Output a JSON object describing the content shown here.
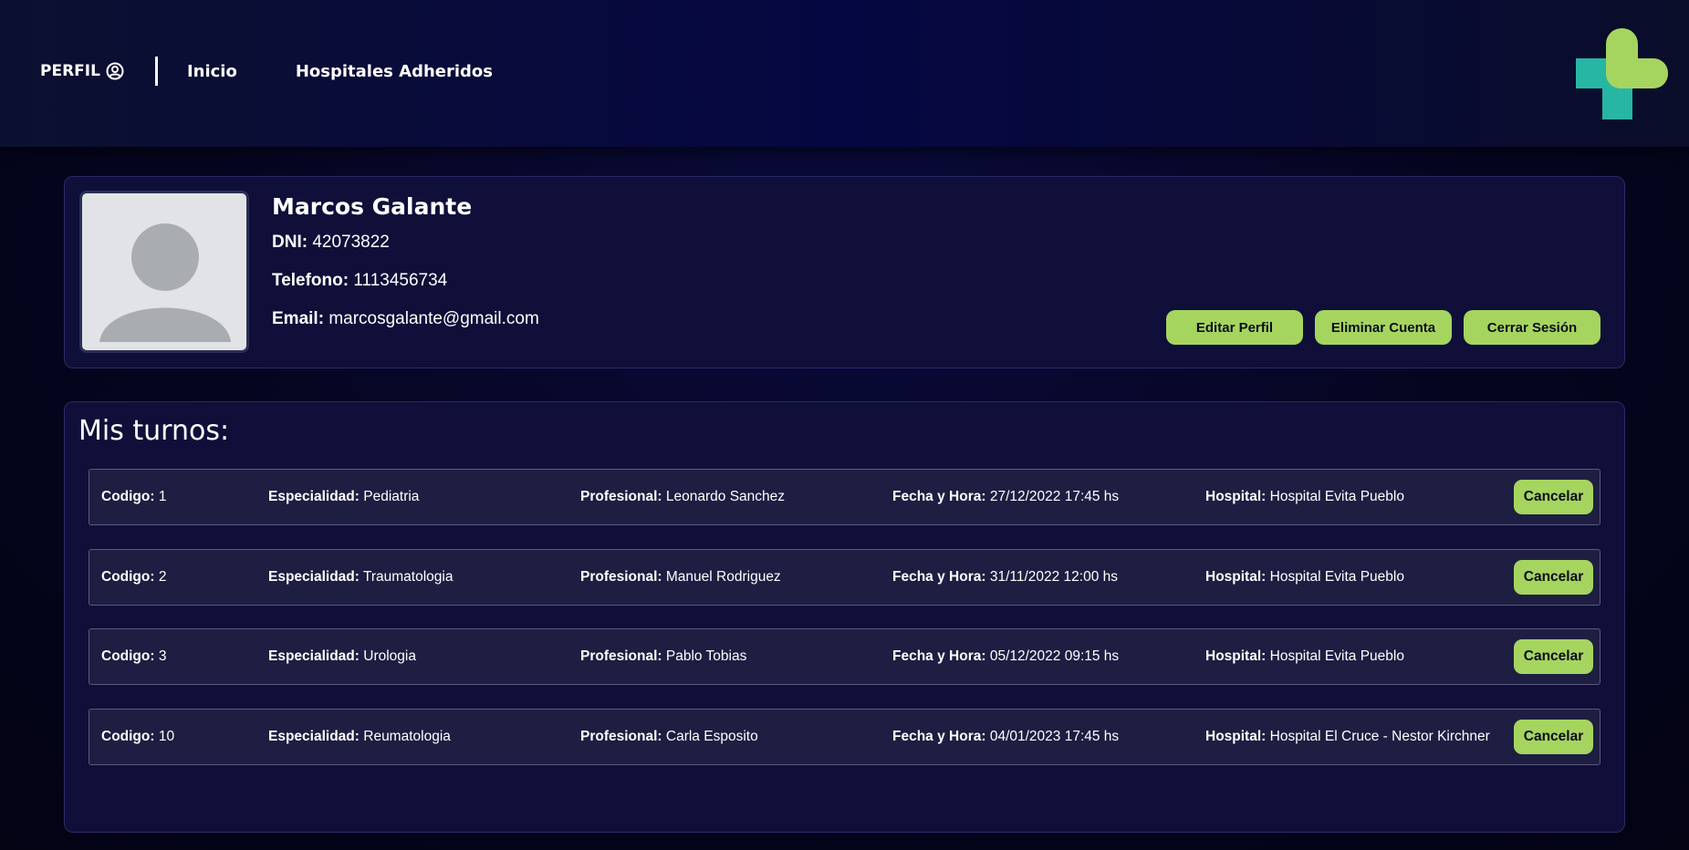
{
  "nav": {
    "perfil": "PERFIL",
    "inicio": "Inicio",
    "hospitales": "Hospitales Adheridos"
  },
  "profile": {
    "name": "Marcos Galante",
    "dni_label": "DNI:",
    "dni": "42073822",
    "telefono_label": "Telefono:",
    "telefono": "1113456734",
    "email_label": "Email:",
    "email": "marcosgalante@gmail.com",
    "buttons": {
      "editar": "Editar Perfil",
      "eliminar": "Eliminar Cuenta",
      "cerrar": "Cerrar Sesión"
    }
  },
  "turnos": {
    "title": "Mis turnos:",
    "labels": {
      "codigo": "Codigo:",
      "especialidad": "Especialidad:",
      "profesional": "Profesional:",
      "fecha": "Fecha y Hora:",
      "hospital": "Hospital:",
      "cancelar": "Cancelar"
    },
    "items": [
      {
        "codigo": "1",
        "especialidad": "Pediatria",
        "profesional": "Leonardo Sanchez",
        "fecha": "27/12/2022 17:45 hs",
        "hospital": "Hospital Evita Pueblo"
      },
      {
        "codigo": "2",
        "especialidad": "Traumatologia",
        "profesional": "Manuel Rodriguez",
        "fecha": "31/11/2022 12:00 hs",
        "hospital": "Hospital Evita Pueblo"
      },
      {
        "codigo": "3",
        "especialidad": "Urologia",
        "profesional": "Pablo Tobias",
        "fecha": "05/12/2022 09:15 hs",
        "hospital": "Hospital Evita Pueblo"
      },
      {
        "codigo": "10",
        "especialidad": "Reumatologia",
        "profesional": "Carla Esposito",
        "fecha": "04/01/2023 17:45 hs",
        "hospital": "Hospital El Cruce - Nestor Kirchner"
      }
    ]
  },
  "colors": {
    "accent": "#a5d55f",
    "logo_teal": "#27b5a4",
    "logo_green": "#a5d55f",
    "panel": "#0f0f3a"
  },
  "icons": [
    "user-circle-icon",
    "avatar-placeholder-icon",
    "medical-cross-logo"
  ]
}
